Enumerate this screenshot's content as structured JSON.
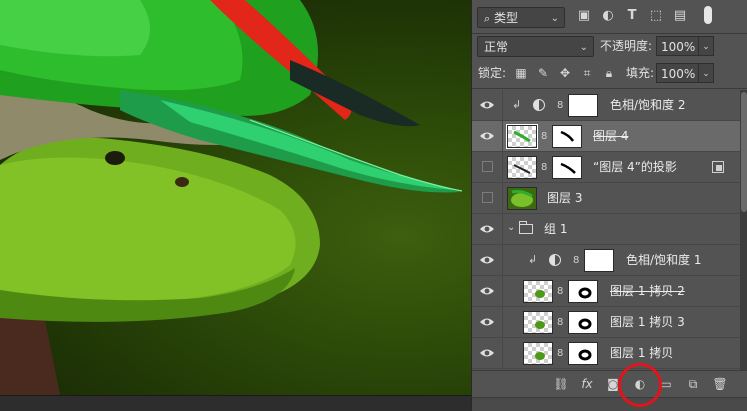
{
  "filter": {
    "label": "类型",
    "icons": [
      "image-filter-icon",
      "adjustment-filter-icon",
      "type-filter-icon",
      "shape-filter-icon",
      "smartobject-filter-icon"
    ]
  },
  "blend_mode": "正常",
  "opacity": {
    "label": "不透明度:",
    "value": "100%"
  },
  "lock": {
    "label": "锁定:"
  },
  "fill": {
    "label": "填充:",
    "value": "100%"
  },
  "layers": [
    {
      "name": "色相/饱和度 2",
      "visible": true,
      "kind": "adjustment",
      "clipped": true
    },
    {
      "name": "图层 4",
      "visible": true,
      "kind": "masked",
      "selected": true,
      "strike": true
    },
    {
      "name": "“图层 4”的投影",
      "visible": false,
      "kind": "masked"
    },
    {
      "name": "图层 3",
      "visible": false,
      "kind": "image"
    },
    {
      "name": "组 1",
      "visible": true,
      "kind": "group"
    },
    {
      "name": "色相/饱和度 1",
      "visible": true,
      "kind": "adjustment",
      "clipped": true,
      "indent": true
    },
    {
      "name": "图层 1 拷贝 2",
      "visible": true,
      "kind": "masked",
      "indent": true,
      "strike": true
    },
    {
      "name": "图层 1 拷贝 3",
      "visible": true,
      "kind": "masked",
      "indent": true
    },
    {
      "name": "图层 1 拷贝",
      "visible": true,
      "kind": "masked",
      "indent": true
    }
  ],
  "toolbar": [
    "link-icon",
    "fx-icon",
    "add-mask-icon",
    "adjustment-layer-icon",
    "new-group-icon",
    "new-layer-icon",
    "trash-icon"
  ],
  "colors": {
    "panel": "#535353",
    "selected": "#6a6a6a",
    "annotation": "#e0141a"
  }
}
